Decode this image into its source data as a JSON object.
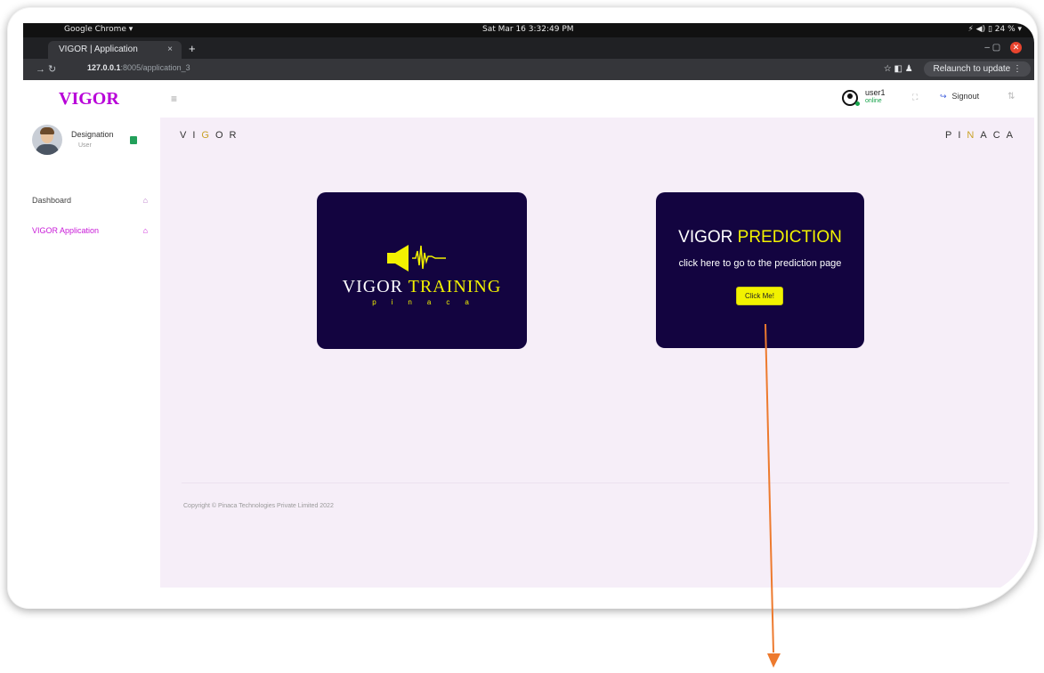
{
  "os_bar": {
    "app_menu": "Google Chrome ▾",
    "clock": "Sat Mar 16  3:32:49 PM",
    "tray": "⚡ ◀) ▯ 24 % ▾"
  },
  "browser": {
    "tab_title": "VIGOR | Application",
    "tab_close": "×",
    "new_tab": "+",
    "window_controls": "–   ▢",
    "close_glyph": "✕",
    "nav_buttons": "→   ↻",
    "url_host": "127.0.0.1",
    "url_rest": ":8005/application_3",
    "toolbar_icons": "☆    ◧    ♟",
    "relaunch_label": "Relaunch to update ⋮"
  },
  "sidebar": {
    "brand": "VIGOR",
    "profile_name": "Designation",
    "profile_role": "User",
    "items": [
      {
        "label": "Dashboard",
        "icon": "home-icon"
      },
      {
        "label": "VIGOR Application",
        "icon": "home-icon",
        "active": true
      }
    ]
  },
  "topnav": {
    "menu_glyph": "≡",
    "user_name": "user1",
    "user_status": "online",
    "fullscreen_glyph": "⛶",
    "signout_label": "Signout",
    "sort_glyph": "⇅"
  },
  "main": {
    "wordmark_left": {
      "before": "VI",
      "highlight": "G",
      "after": "OR"
    },
    "wordmark_right": {
      "before": "PI",
      "highlight": "N",
      "after": "ACA"
    },
    "training_card": {
      "logo_word_white": "VIGOR",
      "logo_word_yellow": "TRAINING",
      "logo_sub": "pinaca"
    },
    "prediction_card": {
      "title_white": "VIGOR",
      "title_yellow": "PREDICTION",
      "description": "click here to go to the prediction page",
      "button_label": "Click Me!"
    },
    "footer": "Copyright © Pinaca Technologies Private Limited 2022"
  },
  "colors": {
    "brand_purple": "#b800d8",
    "active_link": "#c81ad8",
    "card_bg": "#130440",
    "accent_yellow": "#f2f200",
    "page_bg": "#f6eef8",
    "annotation_arrow": "#ed7a2e"
  }
}
